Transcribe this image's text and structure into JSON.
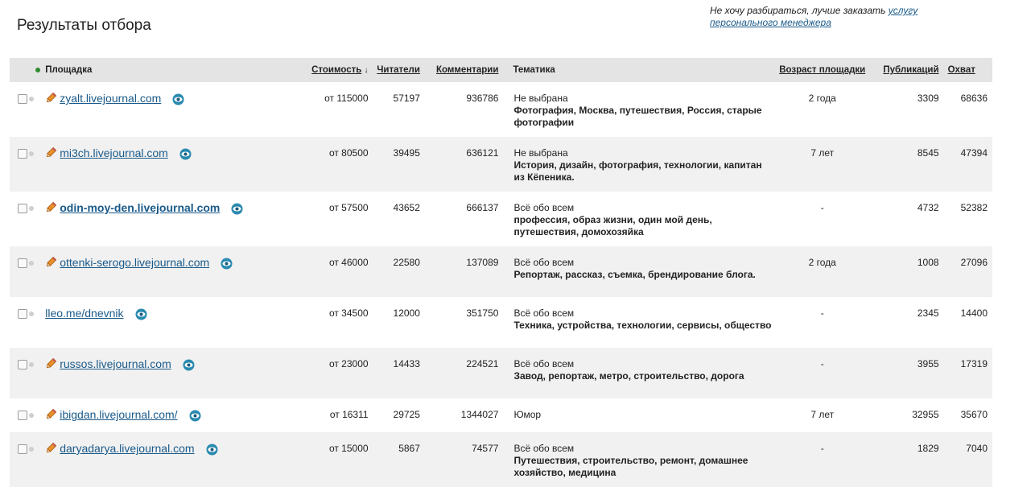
{
  "page_title": "Результаты отбора",
  "promo": {
    "text": "Не хочу разбираться, лучше заказать",
    "link": "услугу персонального менеджера"
  },
  "columns": {
    "site": "Площадка",
    "cost": "Стоимость",
    "cost_sort_arrow": "↓",
    "readers": "Читатели",
    "comments": "Комментарии",
    "topic": "Тематика",
    "age": "Возраст площадки",
    "posts": "Публикаций",
    "reach": "Охват"
  },
  "rows": [
    {
      "site": "zyalt.livejournal.com",
      "cost": "от 115000",
      "readers": "57197",
      "comments": "936786",
      "category": "Не выбрана",
      "tags": "Фотография, Москва, путешествия, Россия, старые фотографии",
      "age": "2 года",
      "posts": "3309",
      "reach": "68636"
    },
    {
      "site": "mi3ch.livejournal.com",
      "cost": "от 80500",
      "readers": "39495",
      "comments": "636121",
      "category": "Не выбрана",
      "tags": "История, дизайн, фотография, технологии, капитан из Кёпеника.",
      "age": "7 лет",
      "posts": "8545",
      "reach": "47394"
    },
    {
      "site": "odin-moy-den.livejournal.com",
      "cost": "от 57500",
      "readers": "43652",
      "comments": "666137",
      "category": "Всё обо всем",
      "tags": "профессия, образ жизни, один мой день, путешествия, домохозяйка",
      "age": "-",
      "posts": "4732",
      "reach": "52382"
    },
    {
      "site": "ottenki-serogo.livejournal.com",
      "cost": "от 46000",
      "readers": "22580",
      "comments": "137089",
      "category": "Всё обо всем",
      "tags": "Репортаж, рассказ, съемка, брендирование блога.",
      "age": "2 года",
      "posts": "1008",
      "reach": "27096"
    },
    {
      "site": "lleo.me/dnevnik",
      "cost": "от 34500",
      "readers": "12000",
      "comments": "351750",
      "category": "Всё обо всем",
      "tags": "Техника, устройства, технологии, сервисы, общество",
      "age": "-",
      "posts": "2345",
      "reach": "14400"
    },
    {
      "site": "russos.livejournal.com",
      "cost": "от 23000",
      "readers": "14433",
      "comments": "224521",
      "category": "Всё обо всем",
      "tags": "Завод, репортаж, метро, строительство, дорога",
      "age": "-",
      "posts": "3955",
      "reach": "17319"
    },
    {
      "site": "ibigdan.livejournal.com/",
      "cost": "от 16311",
      "readers": "29725",
      "comments": "1344027",
      "category": "Юмор",
      "tags": "",
      "age": "7 лет",
      "posts": "32955",
      "reach": "35670"
    },
    {
      "site": "daryadarya.livejournal.com",
      "cost": "от 15000",
      "readers": "5867",
      "comments": "74577",
      "category": "Всё обо всем",
      "tags": "Путешествия, строительство, ремонт, домашнее хозяйство, медицина",
      "age": "-",
      "posts": "1829",
      "reach": "7040"
    }
  ],
  "colors": {
    "link": "#1a5a8a",
    "header_bg": "#e4e4e4",
    "stripe_bg": "#f1f1f1",
    "pencil": "#e8902a",
    "eye": "#2a8ab0",
    "status_dot_header": "#2f8a2f"
  },
  "icons": {
    "pencil": "pencil-icon",
    "eye": "eye-icon",
    "status": "status-dot-icon"
  }
}
